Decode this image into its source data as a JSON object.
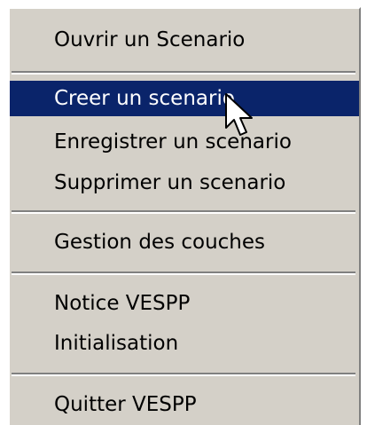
{
  "menu": {
    "items": [
      {
        "label": "Ouvrir un Scenario"
      },
      {
        "label": "Creer un scenario",
        "highlighted": true
      },
      {
        "label": "Enregistrer un scenario"
      },
      {
        "label": "Supprimer un scenario"
      },
      {
        "label": "Gestion des couches"
      },
      {
        "label": "Notice VESPP"
      },
      {
        "label": "Initialisation"
      },
      {
        "label": "Quitter VESPP"
      }
    ]
  },
  "colors": {
    "menu_background": "#d4d0c8",
    "highlight_background": "#0a246a",
    "highlight_text": "#ffffff",
    "separator_shadow": "#808080"
  },
  "cursor": {
    "icon": "arrow-pointer-icon"
  }
}
